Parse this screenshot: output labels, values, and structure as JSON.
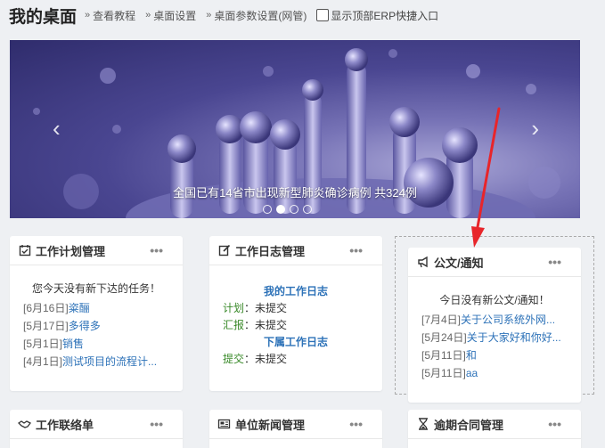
{
  "header": {
    "title": "我的桌面",
    "links": [
      "查看教程",
      "桌面设置",
      "桌面参数设置(网管)"
    ],
    "erp_checkbox_label": "显示顶部ERP快捷入口"
  },
  "banner": {
    "caption": "全国已有14省市出现新型肺炎确诊病例 共324例",
    "prev_icon": "chevron-left-icon",
    "next_icon": "chevron-right-icon",
    "dot_count": 4,
    "active_dot": 2
  },
  "cards": {
    "plan": {
      "title": "工作计划管理",
      "empty": "您今天没有新下达的任务！",
      "items": [
        {
          "date": "[6月16日]",
          "text": "粢酾"
        },
        {
          "date": "[5月17日]",
          "text": "多得多"
        },
        {
          "date": "[5月1日]",
          "text": "销售"
        },
        {
          "date": "[4月1日]",
          "text": "测试项目的流程计..."
        }
      ]
    },
    "log": {
      "title": "工作日志管理",
      "my_head": "我的工作日志",
      "plan_label": "计划",
      "plan_value": "：未提交",
      "report_label": "汇报",
      "report_value": "：未提交",
      "sub_head": "下属工作日志",
      "submit_label": "提交",
      "submit_value": "：未提交"
    },
    "notice": {
      "title": "公文/通知",
      "empty": "今日没有新公文/通知！",
      "items": [
        {
          "date": "[7月4日]",
          "text": "关于公司系统外网..."
        },
        {
          "date": "[5月24日]",
          "text": "关于大家好和你好..."
        },
        {
          "date": "[5月11日]",
          "text": "和"
        },
        {
          "date": "[5月11日]",
          "text": "aa"
        }
      ]
    },
    "contact": {
      "title": "工作联络单"
    },
    "news": {
      "title": "单位新闻管理"
    },
    "contract": {
      "title": "逾期合同管理"
    }
  },
  "more_label": "•••",
  "accent_colors": {
    "link": "#2d72b8",
    "label_green": "#3a8a2a",
    "arrow_red": "#e8252a"
  }
}
